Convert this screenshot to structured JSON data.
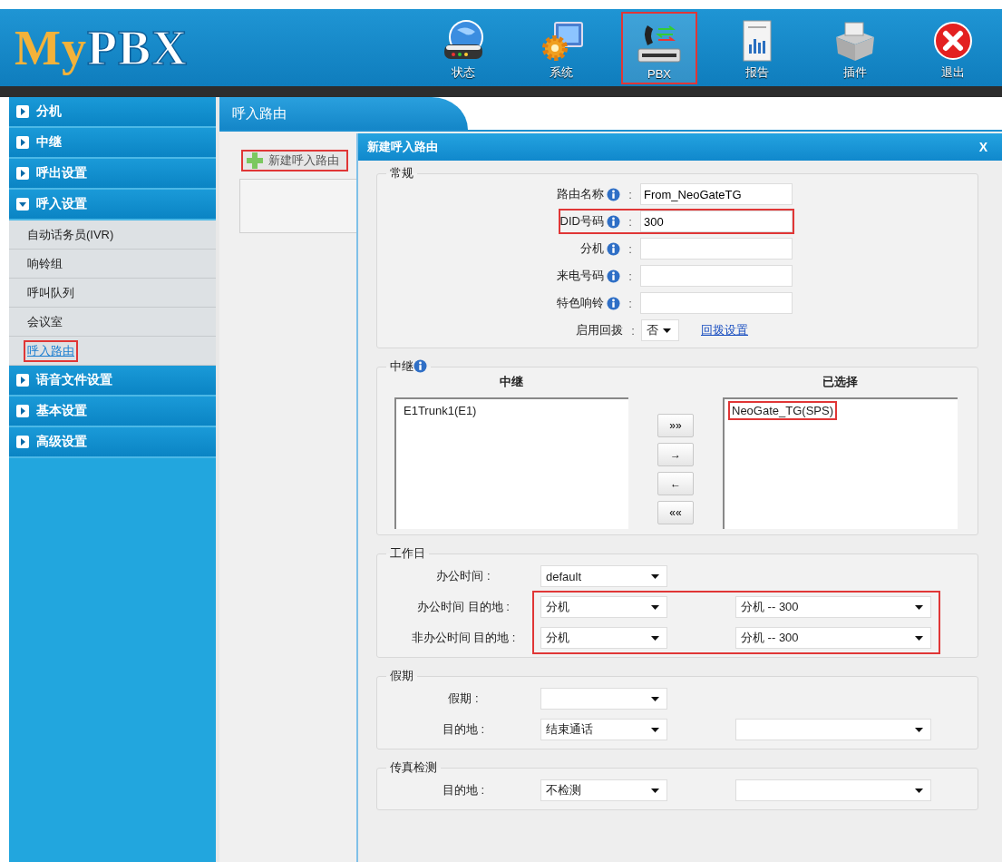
{
  "header": {
    "logo": {
      "prefix": "My",
      "suffix": "PBX"
    },
    "nav": [
      {
        "kind": "status",
        "label": "状态",
        "highlighted": false
      },
      {
        "kind": "system",
        "label": "系统",
        "highlighted": false
      },
      {
        "kind": "pbx",
        "label": "PBX",
        "highlighted": true
      },
      {
        "kind": "report",
        "label": "报告",
        "highlighted": false
      },
      {
        "kind": "plugin",
        "label": "插件",
        "highlighted": false
      },
      {
        "kind": "exit",
        "label": "退出",
        "highlighted": false
      }
    ]
  },
  "sidebar": {
    "groups": [
      {
        "label": "分机",
        "expanded": false
      },
      {
        "label": "中继",
        "expanded": false
      },
      {
        "label": "呼出设置",
        "expanded": false
      },
      {
        "label": "呼入设置",
        "expanded": true,
        "children": [
          {
            "label": "自动话务员(IVR)",
            "selected": false,
            "highlighted": false
          },
          {
            "label": "响铃组",
            "selected": false,
            "highlighted": false
          },
          {
            "label": "呼叫队列",
            "selected": false,
            "highlighted": false
          },
          {
            "label": "会议室",
            "selected": false,
            "highlighted": false
          },
          {
            "label": "呼入路由",
            "selected": true,
            "highlighted": true
          }
        ]
      },
      {
        "label": "语音文件设置",
        "expanded": false
      },
      {
        "label": "基本设置",
        "expanded": false
      },
      {
        "label": "高级设置",
        "expanded": false
      }
    ]
  },
  "content": {
    "tab": "呼入路由",
    "new_button": {
      "label": "新建呼入路由",
      "highlighted": true
    }
  },
  "dialog": {
    "title": "新建呼入路由",
    "close": "X",
    "general": {
      "legend": "常规",
      "fields": [
        {
          "label": "路由名称",
          "info": true,
          "separator": ":",
          "value": "From_NeoGateTG",
          "highlighted": false
        },
        {
          "label": "DID号码",
          "info": true,
          "separator": ":",
          "value": "300",
          "highlighted": true
        },
        {
          "label": "分机",
          "info": true,
          "separator": ":",
          "highlighted": false
        },
        {
          "label": "来电号码",
          "info": true,
          "separator": ":",
          "highlighted": false
        },
        {
          "label": "特色响铃",
          "info": true,
          "separator": ":",
          "highlighted": false
        }
      ],
      "callback": {
        "label": "启用回拨",
        "separator": ":",
        "value": "否",
        "link": "回拨设置"
      }
    },
    "trunks": {
      "legend": "中继",
      "info": true,
      "available_heading": "中继",
      "selected_heading": "已选择",
      "available": [
        {
          "label": "E1Trunk1(E1)",
          "highlighted": false
        }
      ],
      "chosen": [
        {
          "label": "NeoGate_TG(SPS)",
          "highlighted": true
        }
      ],
      "buttons": [
        "»»",
        "→",
        "←",
        "««"
      ]
    },
    "schedules": [
      {
        "legend": "工作日",
        "rows": [
          {
            "label": "办公时间 :",
            "highlighted": false,
            "selects": [
              {
                "kind": "dropdown",
                "value": "default"
              }
            ]
          },
          {
            "label": "办公时间 目的地 :",
            "highlighted": true,
            "selects": [
              {
                "kind": "dropdown",
                "value": "分机"
              },
              {
                "kind": "dropdown",
                "value": "分机 -- 300"
              }
            ]
          },
          {
            "label": "非办公时间 目的地 :",
            "highlighted": true,
            "selects": [
              {
                "kind": "dropdown",
                "value": "分机"
              },
              {
                "kind": "dropdown",
                "value": "分机 -- 300"
              }
            ]
          }
        ]
      },
      {
        "legend": "假期",
        "rows": [
          {
            "label": "假期 :",
            "highlighted": false,
            "selects": [
              {
                "kind": "dropdown"
              }
            ]
          },
          {
            "label": "目的地 :",
            "highlighted": false,
            "selects": [
              {
                "kind": "dropdown",
                "value": "结束通话"
              },
              {
                "kind": "dropdown"
              }
            ]
          }
        ]
      },
      {
        "legend": "传真检测",
        "rows": [
          {
            "label": "目的地 :",
            "highlighted": false,
            "selects": [
              {
                "kind": "dropdown",
                "value": "不检测"
              },
              {
                "kind": "dropdown"
              }
            ]
          }
        ]
      }
    ]
  }
}
